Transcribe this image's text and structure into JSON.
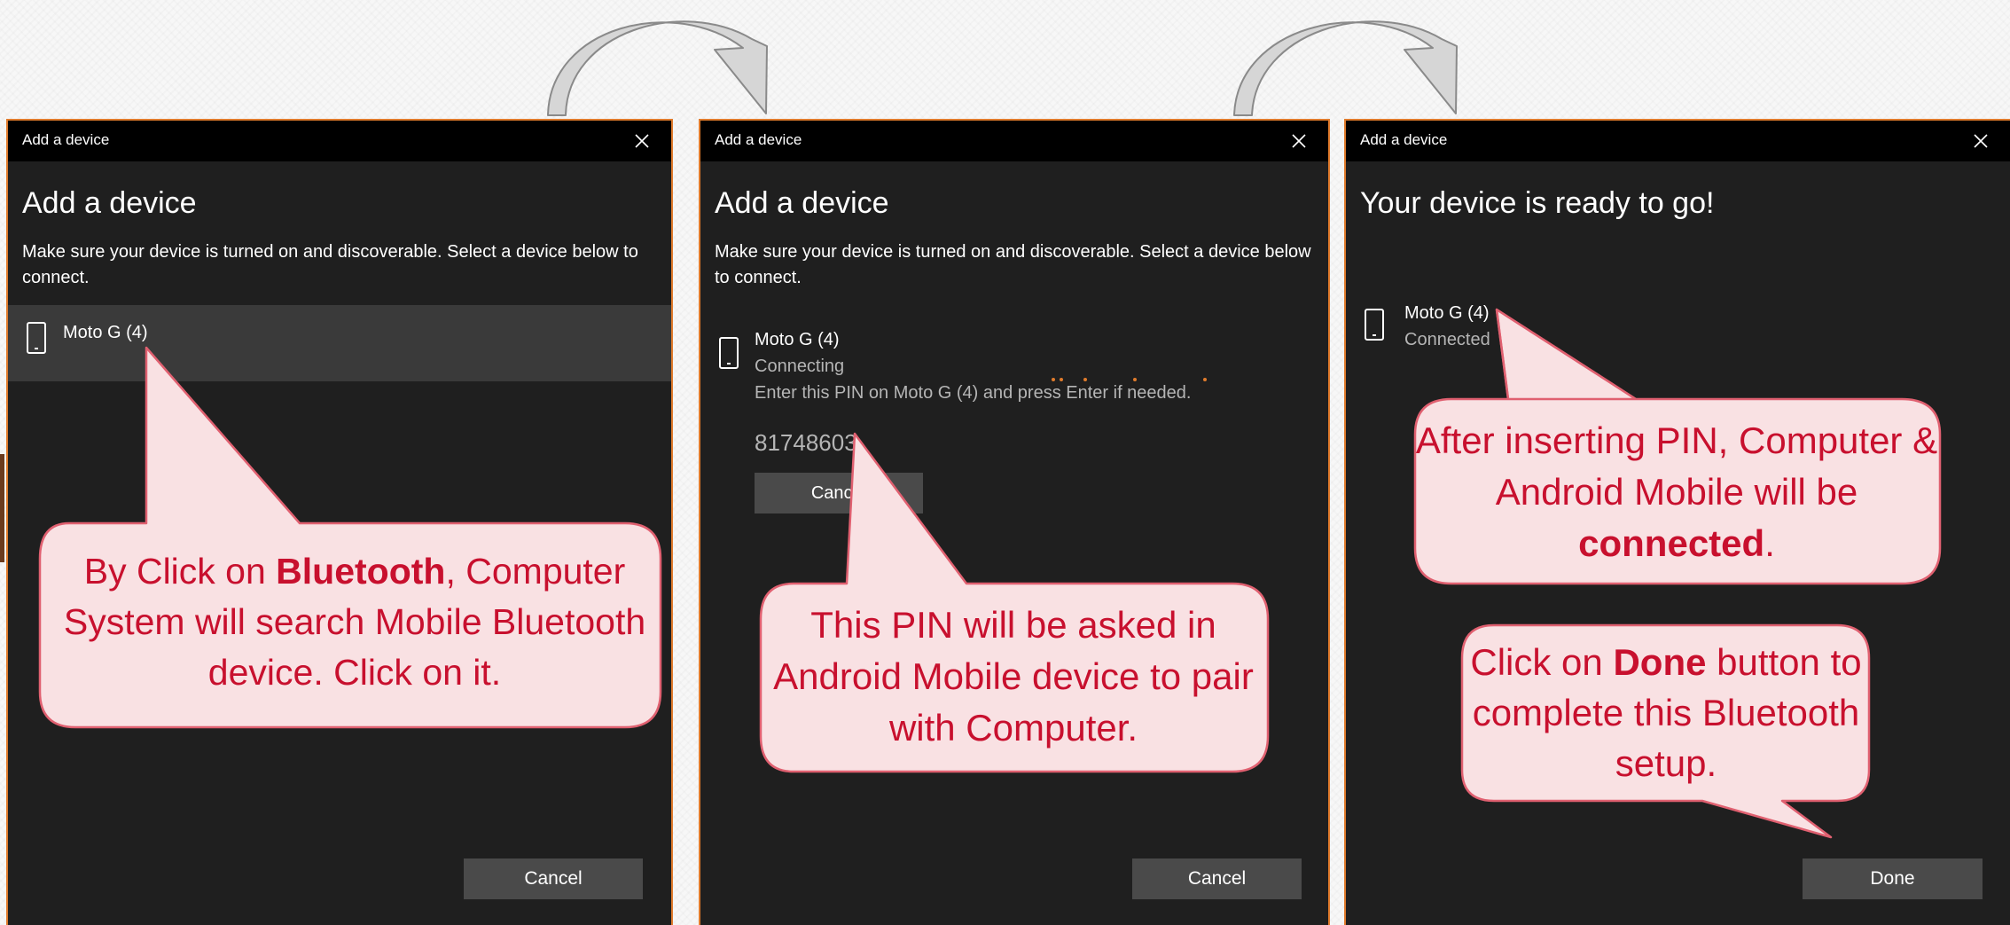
{
  "dialogs": [
    {
      "title": "Add a device",
      "heading": "Add a device",
      "intro": "Make sure your device is turned on and discoverable. Select a device below to connect.",
      "device": {
        "name": "Moto G (4)",
        "icon": "phone-icon"
      },
      "footer_button": "Cancel"
    },
    {
      "title": "Add a device",
      "heading": "Add a device",
      "intro": "Make sure your device is turned on and discoverable. Select a device below to connect.",
      "device": {
        "name": "Moto G (4)",
        "status": "Connecting",
        "icon": "phone-icon"
      },
      "pin_prompt": "Enter this PIN on Moto G (4) and press Enter if needed.",
      "pin": "81748603",
      "inline_button": "Cancel",
      "footer_button": "Cancel"
    },
    {
      "title": "Add a device",
      "heading": "Your device is ready to go!",
      "device": {
        "name": "Moto G (4)",
        "status": "Connected",
        "icon": "phone-icon"
      },
      "footer_button": "Done"
    }
  ],
  "callouts": {
    "c1": {
      "pre": "By Click on ",
      "bold": "Bluetooth",
      "post": ", Computer System will search Mobile Bluetooth device. Click on it."
    },
    "c2": {
      "text": "This PIN will be asked in Android Mobile device to pair with Computer."
    },
    "c3": {
      "pre": "After inserting PIN, Computer & Android Mobile will be ",
      "bold": "connected",
      "post": "."
    },
    "c4": {
      "pre": "Click on ",
      "bold": "Done",
      "post": " button to complete this Bluetooth setup."
    }
  },
  "colors": {
    "dialog_bg": "#1f1f1f",
    "titlebar_bg": "#000000",
    "accent_border": "#e07b2c",
    "button_bg": "#4a4a4a",
    "callout_fill": "#f9e1e3",
    "callout_text": "#c8102e"
  }
}
